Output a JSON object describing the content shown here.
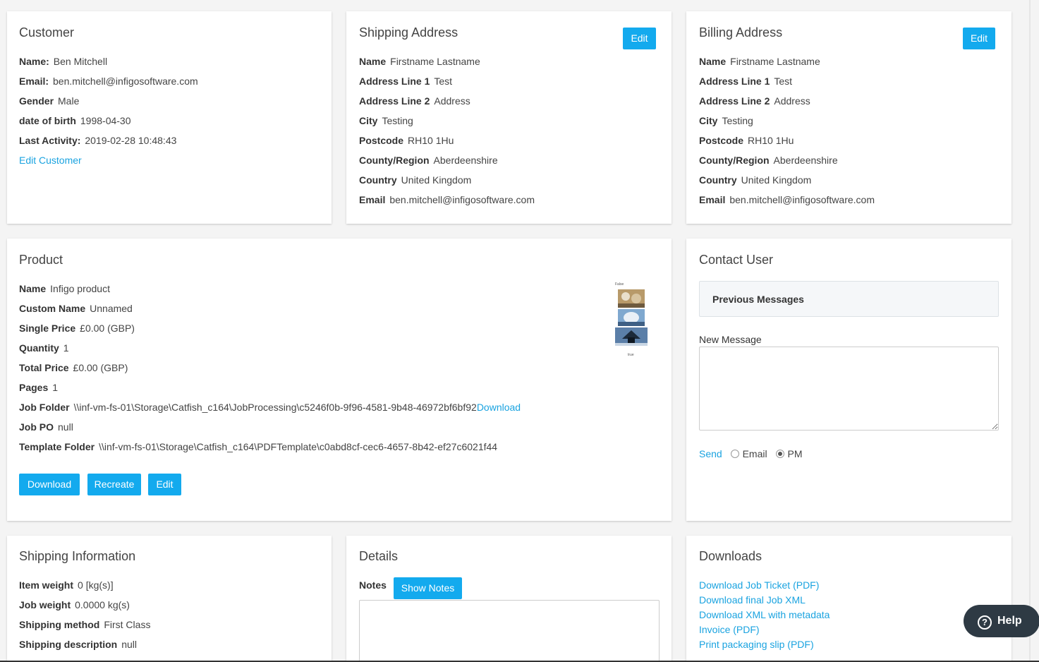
{
  "customer": {
    "title": "Customer",
    "fields": [
      {
        "label": "Name:",
        "value": "Ben Mitchell"
      },
      {
        "label": "Email:",
        "value": "ben.mitchell@infigosoftware.com"
      },
      {
        "label": "Gender",
        "value": "Male"
      },
      {
        "label": "date of birth",
        "value": "1998-04-30"
      },
      {
        "label": "Last Activity:",
        "value": "2019-02-28 10:48:43"
      }
    ],
    "edit_link": "Edit Customer"
  },
  "shipping_address": {
    "title": "Shipping Address",
    "edit_label": "Edit",
    "fields": [
      {
        "label": "Name",
        "value": "Firstname Lastname"
      },
      {
        "label": "Address Line 1",
        "value": "Test"
      },
      {
        "label": "Address Line 2",
        "value": "Address"
      },
      {
        "label": "City",
        "value": "Testing"
      },
      {
        "label": "Postcode",
        "value": "RH10 1Hu"
      },
      {
        "label": "County/Region",
        "value": "Aberdeenshire"
      },
      {
        "label": "Country",
        "value": "United Kingdom"
      },
      {
        "label": "Email",
        "value": "ben.mitchell@infigosoftware.com"
      }
    ]
  },
  "billing_address": {
    "title": "Billing Address",
    "edit_label": "Edit",
    "fields": [
      {
        "label": "Name",
        "value": "Firstname Lastname"
      },
      {
        "label": "Address Line 1",
        "value": "Test"
      },
      {
        "label": "Address Line 2",
        "value": "Address"
      },
      {
        "label": "City",
        "value": "Testing"
      },
      {
        "label": "Postcode",
        "value": "RH10 1Hu"
      },
      {
        "label": "County/Region",
        "value": "Aberdeenshire"
      },
      {
        "label": "Country",
        "value": "United Kingdom"
      },
      {
        "label": "Email",
        "value": "ben.mitchell@infigosoftware.com"
      }
    ]
  },
  "product": {
    "title": "Product",
    "fields": [
      {
        "label": "Name",
        "value": "Infigo product"
      },
      {
        "label": "Custom Name",
        "value": "Unnamed"
      },
      {
        "label": "Single Price",
        "value": "£0.00 (GBP)"
      },
      {
        "label": "Quantity",
        "value": "1"
      },
      {
        "label": "Total Price",
        "value": "£0.00 (GBP)"
      },
      {
        "label": "Pages",
        "value": "1"
      }
    ],
    "job_folder_label": "Job Folder",
    "job_folder_value": "\\\\inf-vm-fs-01\\Storage\\Catfish_c164\\JobProcessing\\c5246f0b-9f96-4581-9b48-46972bf6bf92",
    "job_folder_download": "Download",
    "job_po_label": "Job PO",
    "job_po_value": "null",
    "template_folder_label": "Template Folder",
    "template_folder_value": "\\\\inf-vm-fs-01\\Storage\\Catfish_c164\\PDFTemplate\\c0abd8cf-cec6-4657-8b42-ef27c6021f44",
    "thumb_top_text": "False",
    "thumb_bottom_text": "true",
    "buttons": {
      "download": "Download",
      "recreate": "Recreate",
      "edit": "Edit"
    }
  },
  "contact_user": {
    "title": "Contact User",
    "previous_messages": "Previous Messages",
    "new_message_label": "New Message",
    "send_label": "Send",
    "option_email": "Email",
    "option_pm": "PM",
    "selected": "PM"
  },
  "shipping_information": {
    "title": "Shipping Information",
    "fields": [
      {
        "label": "Item weight",
        "value": "0 [kg(s)]"
      },
      {
        "label": "Job weight",
        "value": "0.0000 kg(s)"
      },
      {
        "label": "Shipping method",
        "value": "First Class"
      },
      {
        "label": "Shipping description",
        "value": "null"
      }
    ]
  },
  "details": {
    "title": "Details",
    "notes_label": "Notes",
    "show_notes": "Show Notes"
  },
  "downloads": {
    "title": "Downloads",
    "links": [
      "Download Job Ticket (PDF)",
      "Download final Job XML",
      "Download XML with metadata",
      "Invoice (PDF)",
      "Print packaging slip (PDF)"
    ]
  },
  "help": {
    "label": "Help"
  },
  "colors": {
    "accent": "#13aaee",
    "link": "#1aa3e0",
    "help_bg": "#2e3a44"
  }
}
